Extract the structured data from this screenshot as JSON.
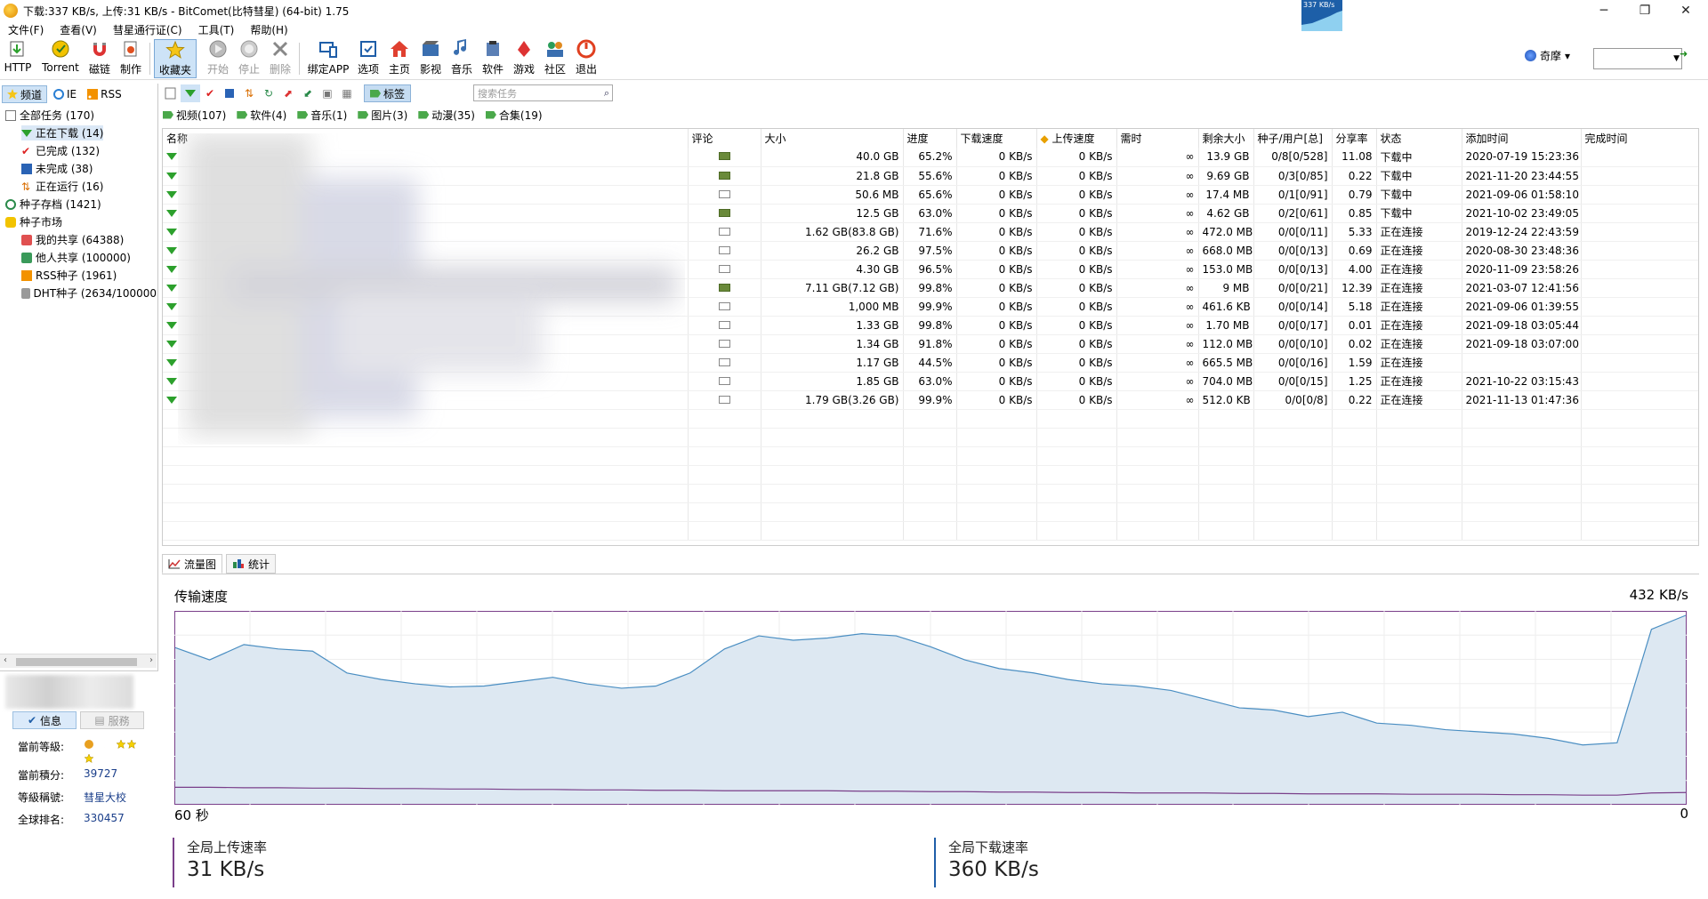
{
  "window": {
    "title": "下载:337 KB/s, 上传:31 KB/s - BitComet(比特彗星) (64-bit) 1.75",
    "mini_speed": "337 KB/s",
    "minimize": "─",
    "restore": "❐",
    "close": "✕"
  },
  "menu": [
    "文件(F)",
    "查看(V)",
    "彗星通行证(C)",
    "工具(T)",
    "帮助(H)"
  ],
  "toolbar": {
    "http": "HTTP",
    "torrent": "Torrent",
    "magnet": "磁链",
    "make": "制作",
    "favorites": "收藏夹",
    "start": "开始",
    "stop": "停止",
    "delete": "删除",
    "bindapp": "绑定APP",
    "options": "选项",
    "home": "主页",
    "video": "影视",
    "music": "音乐",
    "software": "软件",
    "game": "游戏",
    "community": "社区",
    "exit": "退出"
  },
  "user_menu": {
    "label": "奇摩",
    "caret": "▾"
  },
  "left": {
    "tabs": [
      "频道",
      "IE",
      "RSS"
    ],
    "tree": [
      {
        "label": "全部任务 (170)"
      },
      {
        "label": "正在下载 (14)"
      },
      {
        "label": "已完成 (132)"
      },
      {
        "label": "未完成 (38)"
      },
      {
        "label": "正在运行 (16)"
      },
      {
        "label": "种子存档 (1421)"
      },
      {
        "label": "种子市场"
      },
      {
        "label": "我的共享 (64388)"
      },
      {
        "label": "他人共享 (100000)"
      },
      {
        "label": "RSS种子 (1961)"
      },
      {
        "label": "DHT种子 (2634/100000"
      }
    ],
    "scroll_left": "‹",
    "scroll_right": "›"
  },
  "userpanel": {
    "tab_info": "信息",
    "tab_service": "服務",
    "level_label": "當前等級:",
    "score_label": "當前積分:",
    "score": "39727",
    "title_label": "等級稱號:",
    "title": "彗星大校",
    "rank_label": "全球排名:",
    "rank": "330457"
  },
  "tasktools": {
    "tag": "标签",
    "search_placeholder": "搜索任务",
    "search_icon": "⌕"
  },
  "categories": [
    "视频(107)",
    "软件(4)",
    "音乐(1)",
    "图片(3)",
    "动漫(35)",
    "合集(19)"
  ],
  "table": {
    "headers": [
      "名称",
      "评论",
      "大小",
      "进度",
      "下载速度",
      "上传速度",
      "需时",
      "剩余大小",
      "种子/用户[总]",
      "分享率",
      "状态",
      "添加时间",
      "完成时间"
    ],
    "rows": [
      {
        "mail": true,
        "size": "40.0 GB",
        "progress": "65.2%",
        "dl": "0 KB/s",
        "ul": "0 KB/s",
        "eta": "∞",
        "left": "13.9 GB",
        "peers": "0/8[0/528]",
        "ratio": "11.08",
        "status": "下载中",
        "added": "2020-07-19 15:23:36"
      },
      {
        "mail": true,
        "size": "21.8 GB",
        "progress": "55.6%",
        "dl": "0 KB/s",
        "ul": "0 KB/s",
        "eta": "∞",
        "left": "9.69 GB",
        "peers": "0/3[0/85]",
        "ratio": "0.22",
        "status": "下载中",
        "added": "2021-11-20 23:44:55"
      },
      {
        "mail": false,
        "size": "50.6 MB",
        "progress": "65.6%",
        "dl": "0 KB/s",
        "ul": "0 KB/s",
        "eta": "∞",
        "left": "17.4 MB",
        "peers": "0/1[0/91]",
        "ratio": "0.79",
        "status": "下载中",
        "added": "2021-09-06 01:58:10"
      },
      {
        "mail": true,
        "size": "12.5 GB",
        "progress": "63.0%",
        "dl": "0 KB/s",
        "ul": "0 KB/s",
        "eta": "∞",
        "left": "4.62 GB",
        "peers": "0/2[0/61]",
        "ratio": "0.85",
        "status": "下载中",
        "added": "2021-10-02 23:49:05"
      },
      {
        "mail": false,
        "size": "1.62 GB(83.8 GB)",
        "progress": "71.6%",
        "dl": "0 KB/s",
        "ul": "0 KB/s",
        "eta": "∞",
        "left": "472.0 MB",
        "peers": "0/0[0/11]",
        "ratio": "5.33",
        "status": "正在连接",
        "added": "2019-12-24 22:43:59"
      },
      {
        "mail": false,
        "size": "26.2 GB",
        "progress": "97.5%",
        "dl": "0 KB/s",
        "ul": "0 KB/s",
        "eta": "∞",
        "left": "668.0 MB",
        "peers": "0/0[0/13]",
        "ratio": "0.69",
        "status": "正在连接",
        "added": "2020-08-30 23:48:36"
      },
      {
        "mail": false,
        "size": "4.30 GB",
        "progress": "96.5%",
        "dl": "0 KB/s",
        "ul": "0 KB/s",
        "eta": "∞",
        "left": "153.0 MB",
        "peers": "0/0[0/13]",
        "ratio": "4.00",
        "status": "正在连接",
        "added": "2020-11-09 23:58:26"
      },
      {
        "mail": true,
        "size": "7.11 GB(7.12 GB)",
        "progress": "99.8%",
        "dl": "0 KB/s",
        "ul": "0 KB/s",
        "eta": "∞",
        "left": "9 MB",
        "peers": "0/0[0/21]",
        "ratio": "12.39",
        "status": "正在连接",
        "added": "2021-03-07 12:41:56"
      },
      {
        "mail": false,
        "size": "1,000 MB",
        "progress": "99.9%",
        "dl": "0 KB/s",
        "ul": "0 KB/s",
        "eta": "∞",
        "left": "461.6 KB",
        "peers": "0/0[0/14]",
        "ratio": "5.18",
        "status": "正在连接",
        "added": "2021-09-06 01:39:55"
      },
      {
        "mail": false,
        "size": "1.33 GB",
        "progress": "99.8%",
        "dl": "0 KB/s",
        "ul": "0 KB/s",
        "eta": "∞",
        "left": "1.70 MB",
        "peers": "0/0[0/17]",
        "ratio": "0.01",
        "status": "正在连接",
        "added": "2021-09-18 03:05:44"
      },
      {
        "mail": false,
        "size": "1.34 GB",
        "progress": "91.8%",
        "dl": "0 KB/s",
        "ul": "0 KB/s",
        "eta": "∞",
        "left": "112.0 MB",
        "peers": "0/0[0/10]",
        "ratio": "0.02",
        "status": "正在连接",
        "added": "2021-09-18 03:07:00"
      },
      {
        "mail": false,
        "size": "1.17 GB",
        "progress": "44.5%",
        "dl": "0 KB/s",
        "ul": "0 KB/s",
        "eta": "∞",
        "left": "665.5 MB",
        "peers": "0/0[0/16]",
        "ratio": "1.59",
        "status": "正在连接",
        "added": ""
      },
      {
        "mail": false,
        "size": "1.85 GB",
        "progress": "63.0%",
        "dl": "0 KB/s",
        "ul": "0 KB/s",
        "eta": "∞",
        "left": "704.0 MB",
        "peers": "0/0[0/15]",
        "ratio": "1.25",
        "status": "正在连接",
        "added": "2021-10-22 03:15:43"
      },
      {
        "mail": false,
        "size": "1.79 GB(3.26 GB)",
        "progress": "99.9%",
        "dl": "0 KB/s",
        "ul": "0 KB/s",
        "eta": "∞",
        "left": "512.0 KB",
        "peers": "0/0[0/8]",
        "ratio": "0.22",
        "status": "正在连接",
        "added": "2021-11-13 01:47:36"
      }
    ]
  },
  "bottom": {
    "tab_graph": "流量图",
    "tab_stats": "统计",
    "graph_title": "传输速度",
    "graph_max": "432 KB/s",
    "graph_time": "60 秒",
    "graph_zero": "0",
    "upload_label": "全局上传速率",
    "upload_value": "31 KB/s",
    "download_label": "全局下载速率",
    "download_value": "360 KB/s",
    "download_series": [
      358,
      330,
      365,
      355,
      350,
      300,
      285,
      275,
      268,
      270,
      280,
      290,
      275,
      265,
      270,
      300,
      355,
      385,
      375,
      380,
      390,
      385,
      360,
      330,
      310,
      300,
      285,
      275,
      270,
      260,
      240,
      220,
      215,
      200,
      210,
      185,
      180,
      170,
      165,
      160,
      150,
      135,
      140,
      400,
      432
    ],
    "upload_series": [
      38,
      38,
      37,
      37,
      36,
      36,
      35,
      35,
      34,
      34,
      33,
      33,
      32,
      32,
      31,
      31,
      30,
      30,
      30,
      30,
      29,
      29,
      28,
      28,
      27,
      27,
      26,
      26,
      25,
      25,
      25,
      24,
      24,
      23,
      23,
      23,
      22,
      22,
      22,
      21,
      21,
      20,
      20,
      25,
      26
    ]
  },
  "colors": {
    "accent": "#1f5ea8",
    "download_line": "#4a8ec2",
    "download_fill": "#dde8f2",
    "upload_line": "#7a3f8a",
    "green": "#2ca02c"
  }
}
